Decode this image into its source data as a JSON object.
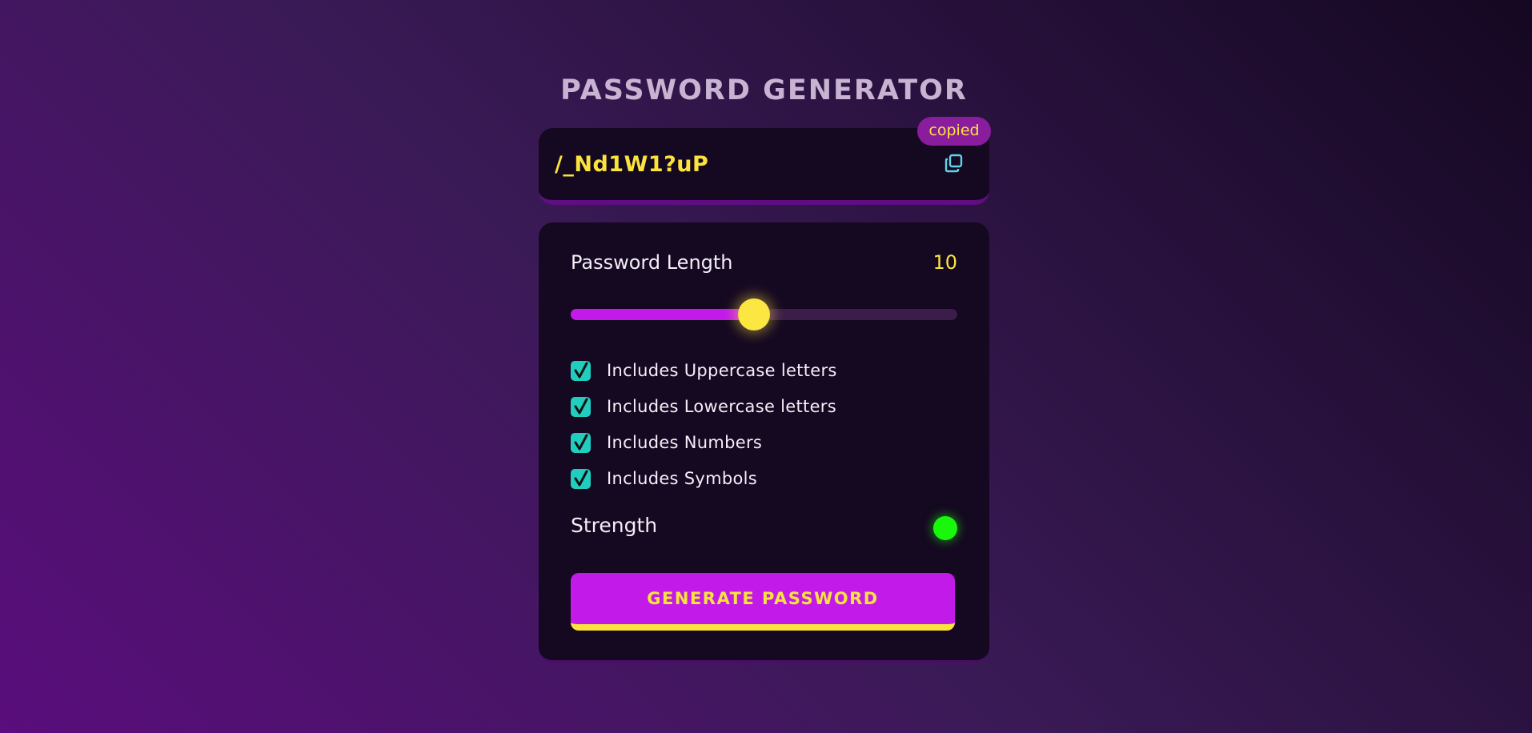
{
  "app": {
    "title": "PASSWORD GENERATOR"
  },
  "display": {
    "password": "/_Nd1W1?uP",
    "copied_badge": "copied",
    "copy_icon": "copy-icon"
  },
  "length": {
    "label": "Password Length",
    "value": "10",
    "slider_fraction": 0.475
  },
  "options": [
    {
      "label": "Includes Uppercase letters",
      "checked": true
    },
    {
      "label": "Includes Lowercase letters",
      "checked": true
    },
    {
      "label": "Includes Numbers",
      "checked": true
    },
    {
      "label": "Includes Symbols",
      "checked": true
    }
  ],
  "strength": {
    "label": "Strength",
    "indicator_color": "#19f70b"
  },
  "actions": {
    "generate_label": "GENERATE PASSWORD"
  },
  "colors": {
    "accent_yellow": "#f9e33c",
    "accent_purple": "#c21ae9",
    "checkbox_teal": "#21cdbf",
    "panel_bg": "#150821"
  }
}
